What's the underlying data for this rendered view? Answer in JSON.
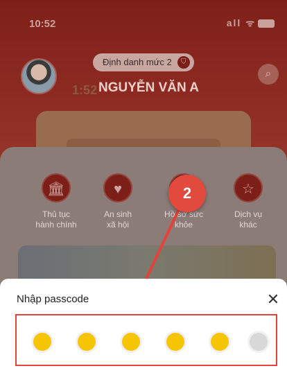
{
  "status_bar": {
    "time": "10:52",
    "icons": "all ᯤ"
  },
  "profile": {
    "badge_label": "Định danh mức 2",
    "badge_icon": "shield-icon",
    "time_overlay": "1:52",
    "name": "NGUYỄN VĂN A"
  },
  "services": [
    {
      "label_line1": "Thủ tục",
      "label_line2": "hành chính",
      "icon": "bank-icon"
    },
    {
      "label_line1": "An sinh",
      "label_line2": "xã hội",
      "icon": "family-icon"
    },
    {
      "label_line1": "Hồ sơ sức",
      "label_line2": "khỏe",
      "icon": "health-icon"
    },
    {
      "label_line1": "Dịch vụ",
      "label_line2": "khác",
      "icon": "star-icon"
    }
  ],
  "annotation": {
    "step_number": "2"
  },
  "passcode_sheet": {
    "title": "Nhập passcode",
    "close_label": "✕",
    "length": 6,
    "filled_count": 5
  },
  "colors": {
    "accent_red": "#e14a3c",
    "dot_filled": "#f7c400",
    "dot_empty": "#d8d8d8"
  }
}
